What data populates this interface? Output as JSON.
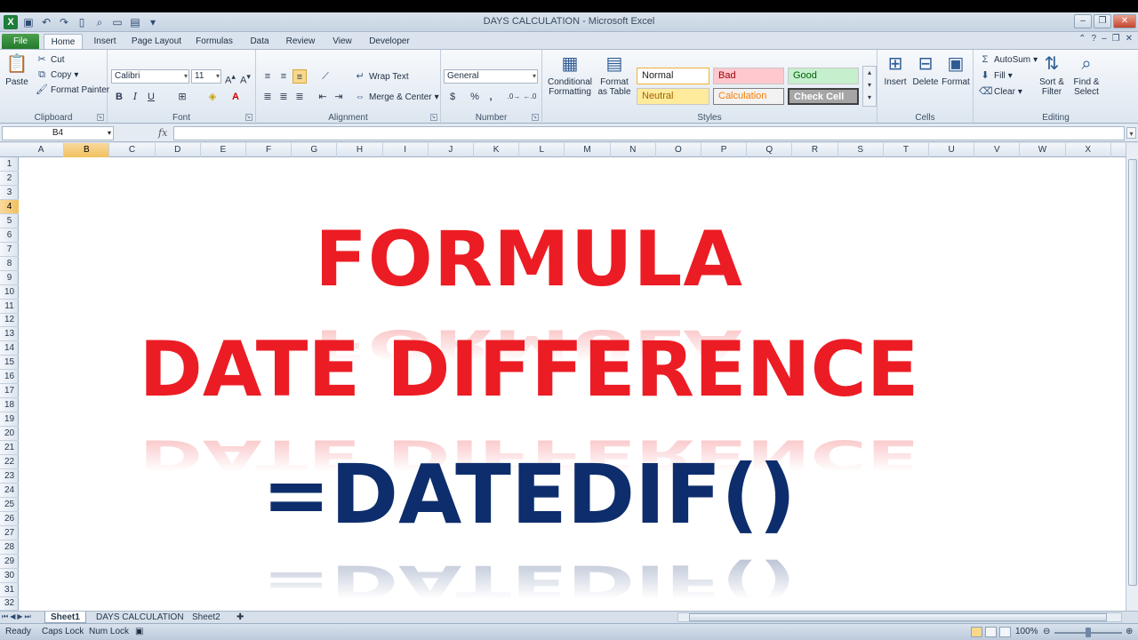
{
  "window": {
    "title": "DAYS CALCULATION  -  Microsoft Excel",
    "controls": [
      "–",
      "❐",
      "✕"
    ]
  },
  "tabs": [
    "File",
    "Home",
    "Insert",
    "Page Layout",
    "Formulas",
    "Data",
    "Review",
    "View",
    "Developer"
  ],
  "ribbon": {
    "clipboard": {
      "label": "Clipboard",
      "paste": "Paste",
      "cut": "Cut",
      "copy": "Copy",
      "format_painter": "Format Painter"
    },
    "font": {
      "label": "Font",
      "name": "Calibri",
      "size": "11",
      "bold": "B",
      "italic": "I",
      "underline": "U"
    },
    "alignment": {
      "label": "Alignment",
      "wrap": "Wrap Text",
      "merge": "Merge & Center"
    },
    "number": {
      "label": "Number",
      "format": "General",
      "percent": "%",
      "comma": ","
    },
    "styles": {
      "label": "Styles",
      "conditional": "Conditional Formatting",
      "format_table": "Format as Table",
      "normal": "Normal",
      "bad": "Bad",
      "good": "Good",
      "neutral": "Neutral",
      "calculation": "Calculation",
      "check_cell": "Check Cell"
    },
    "cells": {
      "label": "Cells",
      "insert": "Insert",
      "delete": "Delete",
      "format": "Format"
    },
    "editing": {
      "label": "Editing",
      "autosum": "AutoSum",
      "fill": "Fill",
      "clear": "Clear",
      "sort": "Sort & Filter",
      "find": "Find & Select"
    }
  },
  "formula_bar": {
    "name_box": "B4",
    "fx": "fx",
    "value": ""
  },
  "columns": [
    "A",
    "B",
    "C",
    "D",
    "E",
    "F",
    "G",
    "H",
    "I",
    "J",
    "K",
    "L",
    "M",
    "N",
    "O",
    "P",
    "Q",
    "R",
    "S",
    "T",
    "U",
    "V",
    "W",
    "X"
  ],
  "selected_column": "B",
  "rows": [
    "1",
    "2",
    "3",
    "4",
    "5",
    "6",
    "7",
    "8",
    "9",
    "10",
    "11",
    "12",
    "13",
    "14",
    "15",
    "16",
    "17",
    "18",
    "19",
    "20",
    "21",
    "22",
    "23",
    "24",
    "25",
    "26",
    "27",
    "28",
    "29",
    "30",
    "31",
    "32"
  ],
  "selected_row": "4",
  "banner": {
    "line1": "FORMULA",
    "line2": "DATE DIFFERENCE",
    "line3": "=DATEDIF()"
  },
  "sheets": [
    "Sheet1",
    "DAYS CALCULATION",
    "Sheet2"
  ],
  "active_sheet": "Sheet1",
  "status": {
    "ready": "Ready",
    "caps": "Caps Lock",
    "num": "Num Lock",
    "zoom": "100%"
  },
  "colors": {
    "banner_red": "#ec1c24",
    "banner_blue": "#0d2d6c",
    "file_tab": "#237a2c",
    "selection": "#f1c15f"
  }
}
